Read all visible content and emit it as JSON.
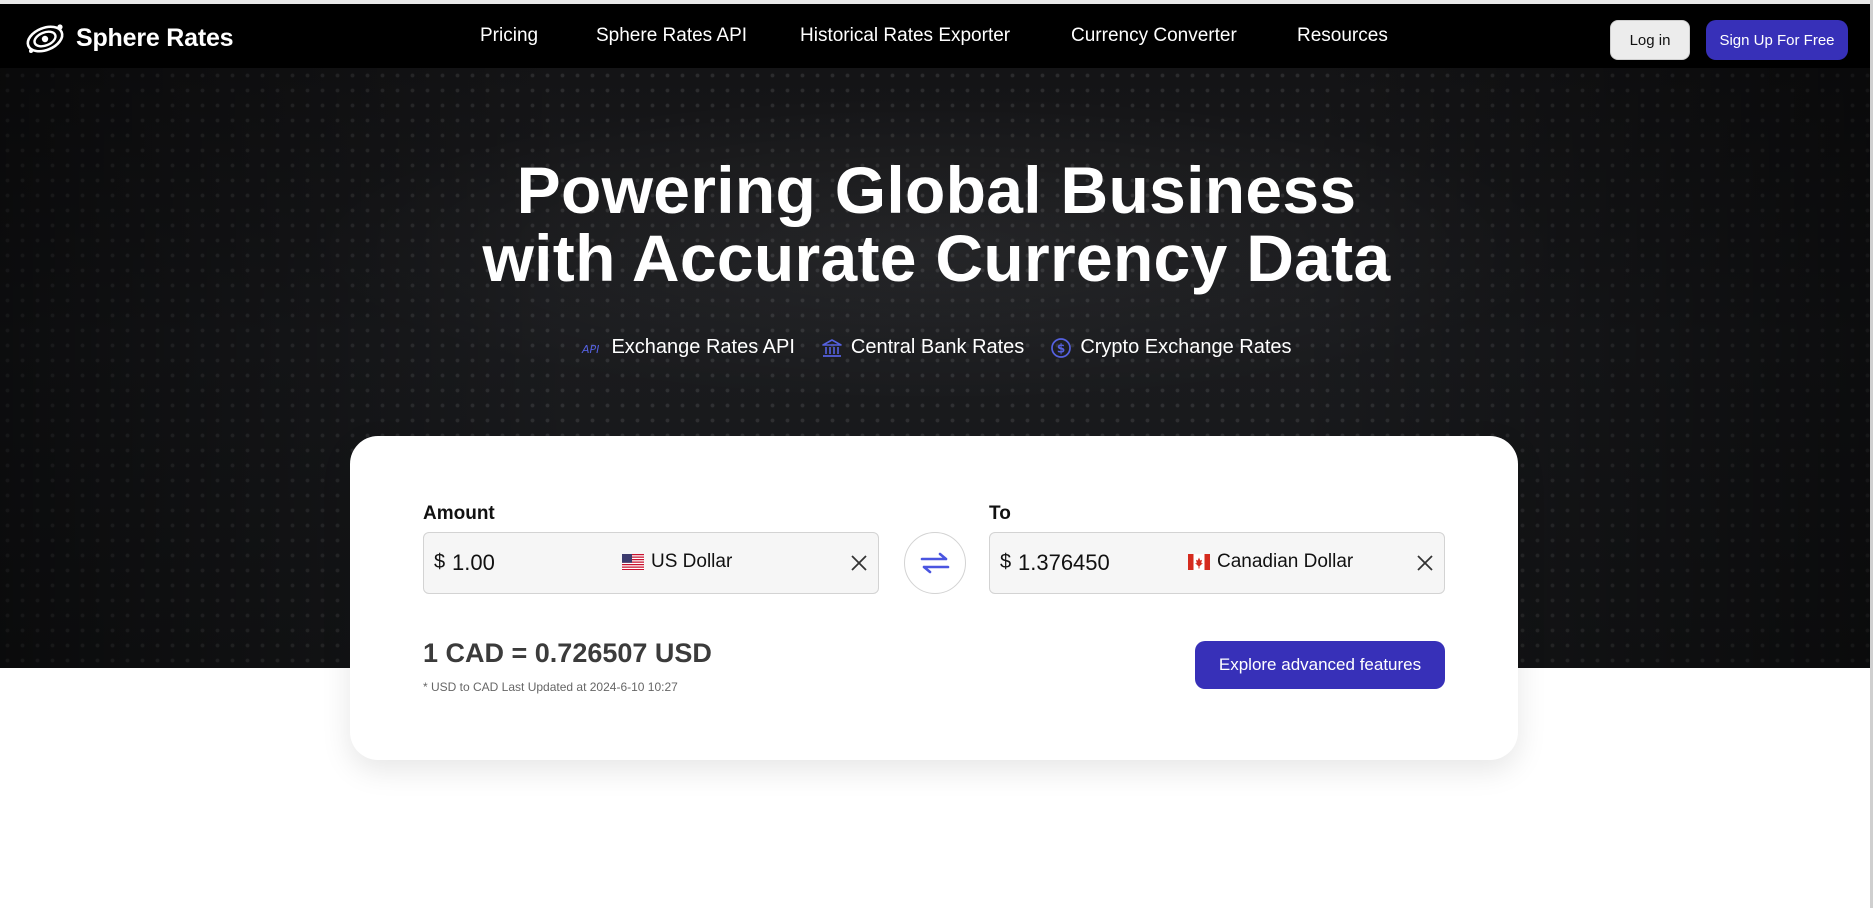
{
  "brand": {
    "name": "Sphere Rates"
  },
  "nav": {
    "items": [
      {
        "label": "Pricing"
      },
      {
        "label": "Sphere Rates API"
      },
      {
        "label": "Historical Rates Exporter"
      },
      {
        "label": "Currency Converter"
      },
      {
        "label": "Resources"
      }
    ],
    "login_label": "Log in",
    "signup_label": "Sign Up For Free"
  },
  "hero": {
    "title_line1": "Powering Global Business",
    "title_line2": "with Accurate Currency Data",
    "features": [
      {
        "icon": "api-icon",
        "label": "Exchange Rates API"
      },
      {
        "icon": "bank-icon",
        "label": "Central Bank Rates"
      },
      {
        "icon": "dollar-coin-icon",
        "label": "Crypto Exchange Rates"
      }
    ]
  },
  "converter": {
    "amount_label": "Amount",
    "to_label": "To",
    "from": {
      "symbol": "$",
      "value": "1.00",
      "currency": "US Dollar",
      "flag": "us-flag-icon"
    },
    "to": {
      "symbol": "$",
      "value": "1.376450",
      "currency": "Canadian Dollar",
      "flag": "ca-flag-icon"
    },
    "rate_text": "1 CAD = 0.726507 USD",
    "updated_text": "* USD to CAD Last Updated at 2024-6-10 10:27",
    "explore_label": "Explore advanced features"
  },
  "colors": {
    "brand_primary": "#3730b8",
    "icon_accent": "#5561e0",
    "topbar": "#000000",
    "hero_bg": "#1a1b1e"
  }
}
